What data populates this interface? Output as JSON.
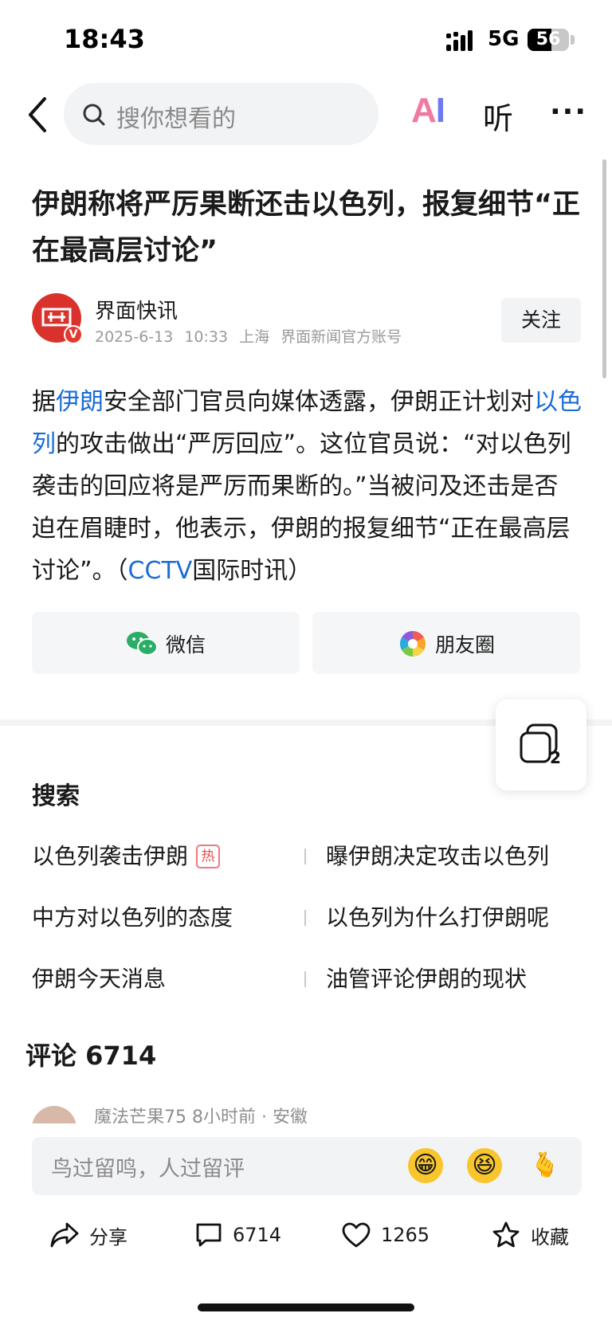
{
  "status_bar": {
    "time": "18:43",
    "network": "5G",
    "battery": "56"
  },
  "nav": {
    "search_placeholder": "搜你想看的",
    "ai_label_a": "A",
    "ai_label_i": "I",
    "listen_label": "听",
    "more_label": "···"
  },
  "article": {
    "title": "伊朗称将严厉果断还击以色列，报复细节“正在最高层讨论”",
    "author": {
      "name": "界面快讯",
      "date": "2025-6-13",
      "time": "10:33",
      "location": "上海",
      "account_type": "界面新闻官方账号",
      "follow_label": "关注",
      "verified_mark": "V"
    },
    "body": {
      "p1": "据",
      "link1": "伊朗",
      "p2": "安全部门官员向媒体透露，伊朗正计划对",
      "link2": "以色列",
      "p3": "的攻击做出“严厉回应”。这位官员说：“对以色列袭击的回应将是严厉而果断的。”当被问及还击是否迫在眉睫时，他表示，伊朗的报复细节“正在最高层讨论”。（",
      "link3": "CCTV",
      "p4": "国际时讯）"
    }
  },
  "share": {
    "wechat_label": "微信",
    "moments_label": "朋友圈"
  },
  "floating": {
    "icon": "stacked-cards-icon",
    "count": "2"
  },
  "search_section": {
    "heading": "搜索",
    "hot_badge": "热",
    "items": [
      "以色列袭击伊朗",
      "曝伊朗决定攻击以色列",
      "中方对以色列的态度",
      "以色列为什么打伊朗呢",
      "伊朗今天消息",
      "油管评论伊朗的现状"
    ]
  },
  "comments": {
    "heading": "评论 6714",
    "peek_user": "魔法芒果75",
    "peek_time": "8小时前",
    "peek_location": "安徽",
    "input_placeholder": "鸟过留鸣，人过留评",
    "emojis": [
      "😁",
      "😆",
      "🫰"
    ]
  },
  "actions": {
    "share_label": "分享",
    "comment_count": "6714",
    "like_count": "1265",
    "favorite_label": "收藏"
  },
  "colors": {
    "link": "#1a6cd6",
    "brand_red": "#d9322c",
    "wechat_green": "#2aae67"
  }
}
